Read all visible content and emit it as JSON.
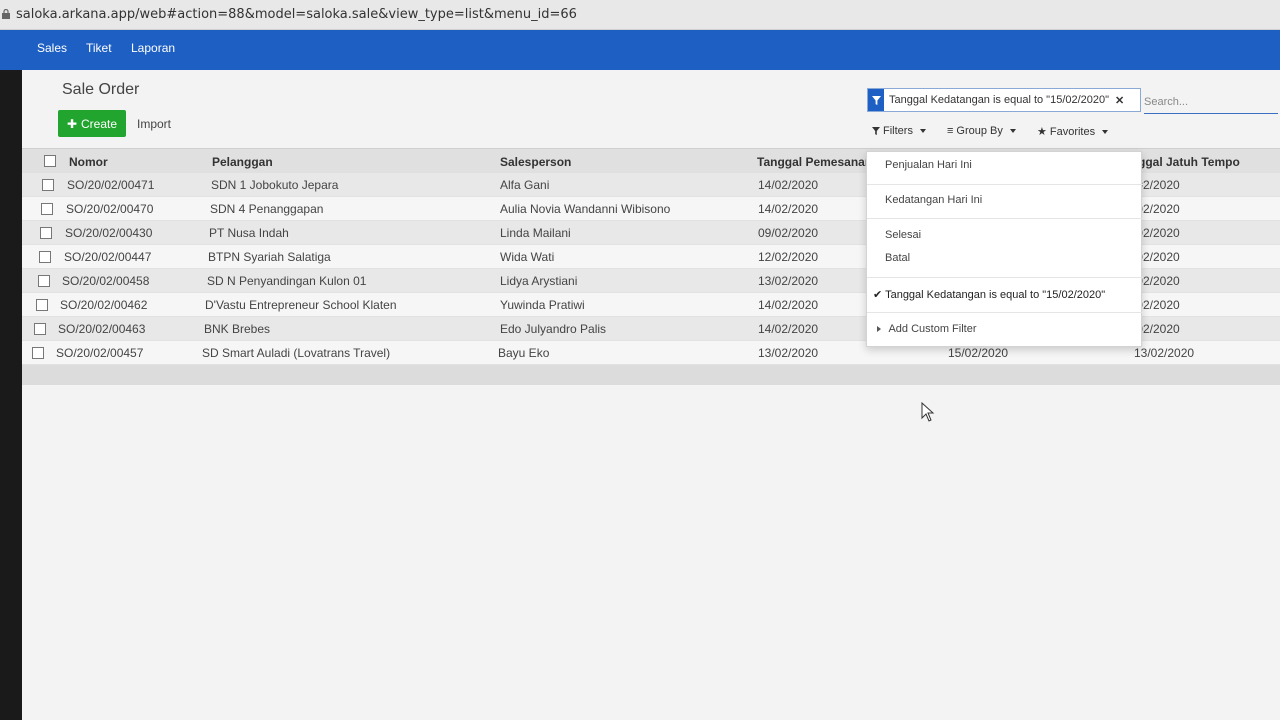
{
  "browser": {
    "url": "saloka.arkana.app/web#action=88&model=saloka.sale&view_type=list&menu_id=66"
  },
  "nav": {
    "items": [
      "Sales",
      "Tiket",
      "Laporan"
    ]
  },
  "page": {
    "title": "Sale Order",
    "create_label": "Create",
    "import_label": "Import"
  },
  "search": {
    "facet_text": "Tanggal Kedatangan is equal to \"15/02/2020\"",
    "placeholder": "Search...",
    "filters_label": "Filters",
    "groupby_label": "Group By",
    "favorites_label": "Favorites"
  },
  "table": {
    "columns": [
      "Nomor",
      "Pelanggan",
      "Salesperson",
      "Tanggal Pemesanan",
      "ggal Jatuh Tempo"
    ],
    "rows": [
      {
        "nomor": "SO/20/02/00471",
        "pelanggan": "SDN 1 Jobokuto Jepara",
        "sales": "Alfa Gani",
        "pesan": "14/02/2020",
        "tempo": "'02/2020"
      },
      {
        "nomor": "SO/20/02/00470",
        "pelanggan": "SDN 4 Penanggapan",
        "sales": "Aulia Novia Wandanni Wibisono",
        "pesan": "14/02/2020",
        "tempo": "'02/2020"
      },
      {
        "nomor": "SO/20/02/00430",
        "pelanggan": "PT Nusa Indah",
        "sales": "Linda Mailani",
        "pesan": "09/02/2020",
        "tempo": "'02/2020"
      },
      {
        "nomor": "SO/20/02/00447",
        "pelanggan": "BTPN Syariah Salatiga",
        "sales": "Wida Wati",
        "pesan": "12/02/2020",
        "tempo": "'02/2020"
      },
      {
        "nomor": "SO/20/02/00458",
        "pelanggan": "SD N Penyandingan Kulon 01",
        "sales": "Lidya Arystiani",
        "pesan": "13/02/2020",
        "tempo": "'02/2020"
      },
      {
        "nomor": "SO/20/02/00462",
        "pelanggan": "D'Vastu Entrepreneur School Klaten",
        "sales": "Yuwinda Pratiwi",
        "pesan": "14/02/2020",
        "tempo": "'02/2020"
      },
      {
        "nomor": "SO/20/02/00463",
        "pelanggan": "BNK Brebes",
        "sales": "Edo Julyandro Palis",
        "pesan": "14/02/2020",
        "tempo": "'02/2020"
      },
      {
        "nomor": "SO/20/02/00457",
        "pelanggan": "SD Smart Auladi (Lovatrans Travel)",
        "sales": "Bayu Eko",
        "pesan": "13/02/2020",
        "kedatangan": "15/02/2020",
        "tempo": "13/02/2020"
      }
    ]
  },
  "filters_menu": {
    "items": [
      "Penjualan Hari Ini",
      "Kedatangan Hari Ini",
      "Selesai",
      "Batal"
    ],
    "active": "Tanggal Kedatangan is equal to \"15/02/2020\"",
    "custom": "Add Custom Filter"
  }
}
